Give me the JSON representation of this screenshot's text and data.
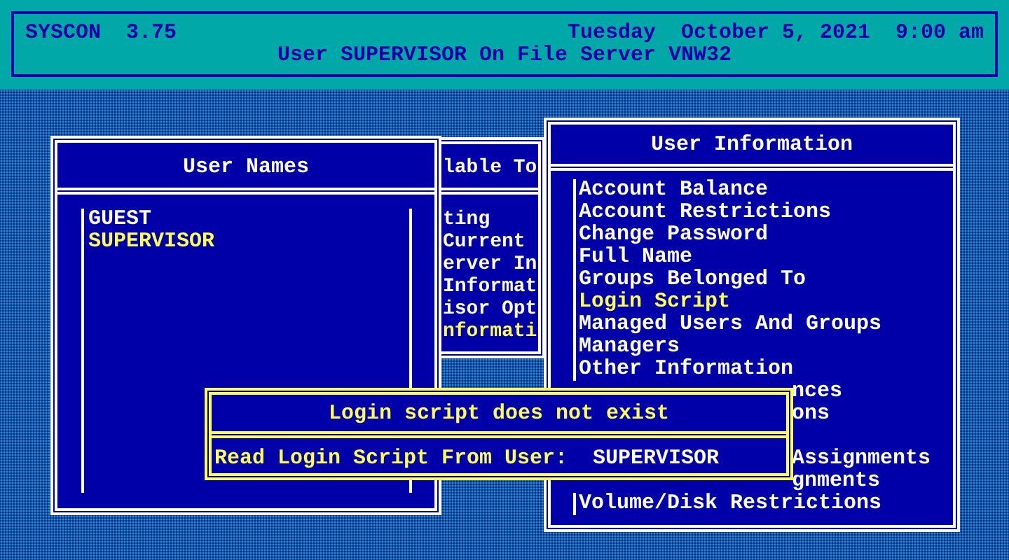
{
  "header": {
    "app": "SYSCON  3.75",
    "datetime": "Tuesday  October 5, 2021  9:00 am",
    "subtitle": "User SUPERVISOR On File Server VNW32"
  },
  "topics_window": {
    "title": "lable To",
    "items": [
      {
        "text": "ting",
        "selected": false
      },
      {
        "text": "Current",
        "selected": false
      },
      {
        "text": "erver In",
        "selected": false
      },
      {
        "text": "Informat",
        "selected": false
      },
      {
        "text": "isor Opt",
        "selected": false
      },
      {
        "text": "nformati",
        "selected": true
      }
    ]
  },
  "user_names": {
    "title": "User Names",
    "items": [
      {
        "text": "GUEST",
        "selected": false
      },
      {
        "text": "SUPERVISOR",
        "selected": true
      }
    ]
  },
  "user_information": {
    "title": "User Information",
    "items": [
      {
        "kind": "full",
        "text": "Account Balance",
        "selected": false
      },
      {
        "kind": "full",
        "text": "Account Restrictions",
        "selected": false
      },
      {
        "kind": "full",
        "text": "Change Password",
        "selected": false
      },
      {
        "kind": "full",
        "text": "Full Name",
        "selected": false
      },
      {
        "kind": "full",
        "text": "Groups Belonged To",
        "selected": false
      },
      {
        "kind": "full",
        "text": "Login Script",
        "selected": true
      },
      {
        "kind": "full",
        "text": "Managed Users And Groups",
        "selected": false
      },
      {
        "kind": "full",
        "text": "Managers",
        "selected": false
      },
      {
        "kind": "full",
        "text": "Other Information",
        "selected": false
      },
      {
        "kind": "partial",
        "text": "nces",
        "selected": false
      },
      {
        "kind": "partial",
        "text": "ons",
        "selected": false
      },
      {
        "kind": "covered"
      },
      {
        "kind": "partial",
        "text": "Assignments",
        "selected": false
      },
      {
        "kind": "partial",
        "text": "gnments",
        "selected": false
      },
      {
        "kind": "full",
        "text": "Volume/Disk Restrictions",
        "selected": false
      }
    ]
  },
  "dialog": {
    "message": "Login script does not exist",
    "prompt": {
      "label": "Read Login Script From User:",
      "value": "SUPERVISOR"
    }
  }
}
